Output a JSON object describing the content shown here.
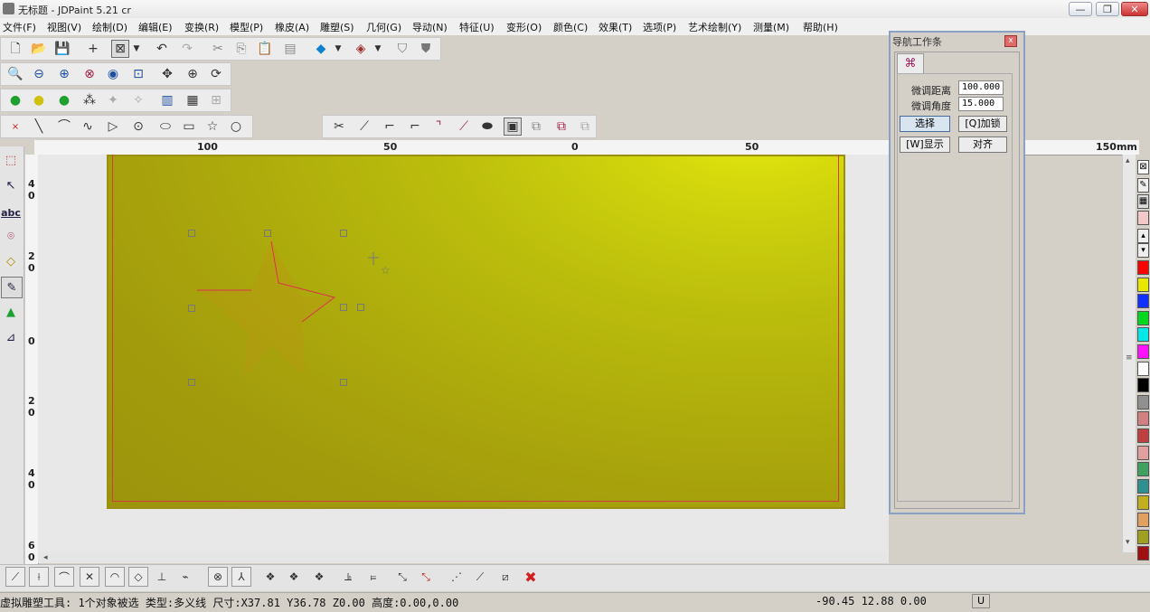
{
  "window": {
    "title": "无标题 - JDPaint 5.21 cr",
    "minimize": "—",
    "restore": "❐",
    "close": "✕"
  },
  "menu": [
    {
      "label": "文件(F)"
    },
    {
      "label": "视图(V)"
    },
    {
      "label": "绘制(D)"
    },
    {
      "label": "编辑(E)"
    },
    {
      "label": "变换(R)"
    },
    {
      "label": "模型(P)"
    },
    {
      "label": "橡皮(A)"
    },
    {
      "label": "雕塑(S)"
    },
    {
      "label": "几何(G)"
    },
    {
      "label": "导动(N)"
    },
    {
      "label": "特征(U)"
    },
    {
      "label": "变形(O)"
    },
    {
      "label": "颜色(C)"
    },
    {
      "label": "效果(T)"
    },
    {
      "label": "选项(P)"
    },
    {
      "label": "艺术绘制(Y)"
    },
    {
      "label": "测量(M)"
    },
    {
      "label": "帮助(H)"
    }
  ],
  "rulers": {
    "h_labels": [
      "100",
      "50",
      "0",
      "50",
      "150mm"
    ],
    "v_labels": [
      "4\n0",
      "2\n0",
      "0",
      "2\n0",
      "4\n0",
      "6\n0"
    ]
  },
  "nav_panel": {
    "title": "导航工作条",
    "close": "x",
    "fine_distance_label": "微调距离",
    "fine_distance_value": "100.000",
    "fine_angle_label": "微调角度",
    "fine_angle_value": "15.000",
    "select_button": "选择",
    "lock_button": "[Q]加锁",
    "show_button": "[W]显示",
    "align_button": "对齐"
  },
  "status": {
    "message": "虚拟雕塑工具: 1个对象被选 类型:多义线 尺寸:X37.81 Y36.78 Z0.00 高度:0.00,0.00",
    "coords": "-90.45 12.88 0.00",
    "unit_button": "U"
  },
  "colors": {
    "palette": [
      "#ff0000",
      "#e8e800",
      "#1030ff",
      "#00d820",
      "#00e8e8",
      "#ff10ff",
      "#ffffff",
      "#000000",
      "#909090",
      "#d08080",
      "#c04040",
      "#e0a0a0",
      "#40a060",
      "#309090",
      "#c0b020",
      "#e0a060",
      "#a0a020",
      "#a01010"
    ]
  }
}
